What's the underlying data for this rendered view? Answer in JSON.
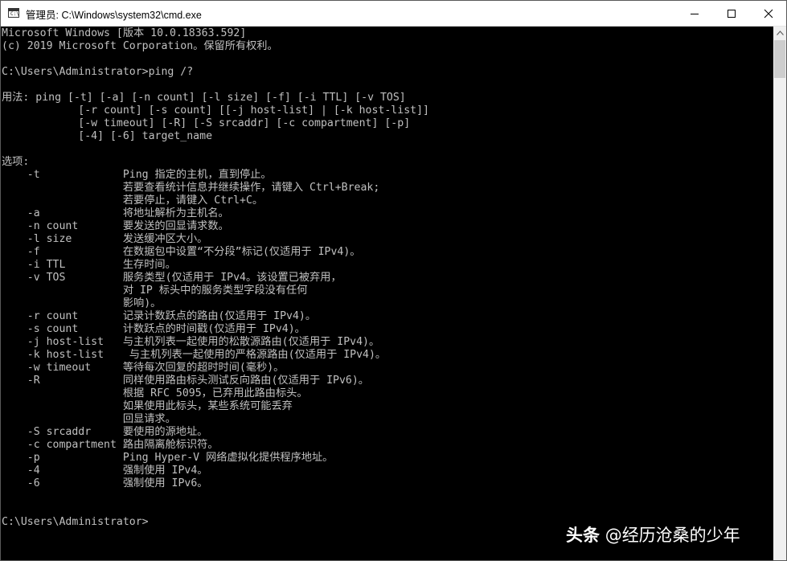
{
  "window": {
    "title": "管理员: C:\\Windows\\system32\\cmd.exe",
    "icon": "cmd-icon",
    "icon_text": "C:\\"
  },
  "controls": {
    "minimize": "minimize-icon",
    "maximize": "maximize-icon",
    "close": "close-icon"
  },
  "console": {
    "lines": [
      "Microsoft Windows [版本 10.0.18363.592]",
      "(c) 2019 Microsoft Corporation。保留所有权利。",
      "",
      "C:\\Users\\Administrator>ping /?",
      "",
      "用法: ping [-t] [-a] [-n count] [-l size] [-f] [-i TTL] [-v TOS]",
      "            [-r count] [-s count] [[-j host-list] | [-k host-list]]",
      "            [-w timeout] [-R] [-S srcaddr] [-c compartment] [-p]",
      "            [-4] [-6] target_name",
      "",
      "选项:",
      "    -t             Ping 指定的主机，直到停止。",
      "                   若要查看统计信息并继续操作，请键入 Ctrl+Break;",
      "                   若要停止，请键入 Ctrl+C。",
      "    -a             将地址解析为主机名。",
      "    -n count       要发送的回显请求数。",
      "    -l size        发送缓冲区大小。",
      "    -f             在数据包中设置“不分段”标记(仅适用于 IPv4)。",
      "    -i TTL         生存时间。",
      "    -v TOS         服务类型(仅适用于 IPv4。该设置已被弃用，",
      "                   对 IP 标头中的服务类型字段没有任何",
      "                   影响)。",
      "    -r count       记录计数跃点的路由(仅适用于 IPv4)。",
      "    -s count       计数跃点的时间戳(仅适用于 IPv4)。",
      "    -j host-list   与主机列表一起使用的松散源路由(仅适用于 IPv4)。",
      "    -k host-list    与主机列表一起使用的严格源路由(仅适用于 IPv4)。",
      "    -w timeout     等待每次回复的超时时间(毫秒)。",
      "    -R             同样使用路由标头测试反向路由(仅适用于 IPv6)。",
      "                   根据 RFC 5095，已弃用此路由标头。",
      "                   如果使用此标头，某些系统可能丢弃",
      "                   回显请求。",
      "    -S srcaddr     要使用的源地址。",
      "    -c compartment 路由隔离舱标识符。",
      "    -p             Ping Hyper-V 网络虚拟化提供程序地址。",
      "    -4             强制使用 IPv4。",
      "    -6             强制使用 IPv6。",
      "",
      "",
      "C:\\Users\\Administrator>"
    ]
  },
  "watermark": {
    "brand": "头条",
    "handle": "@经历沧桑的少年"
  },
  "colors": {
    "console_bg": "#000000",
    "console_text": "#c0c0c0",
    "titlebar_bg": "#ffffff",
    "scrollbar_bg": "#f0f0f0",
    "scrollbar_thumb": "#cdcdcd"
  }
}
